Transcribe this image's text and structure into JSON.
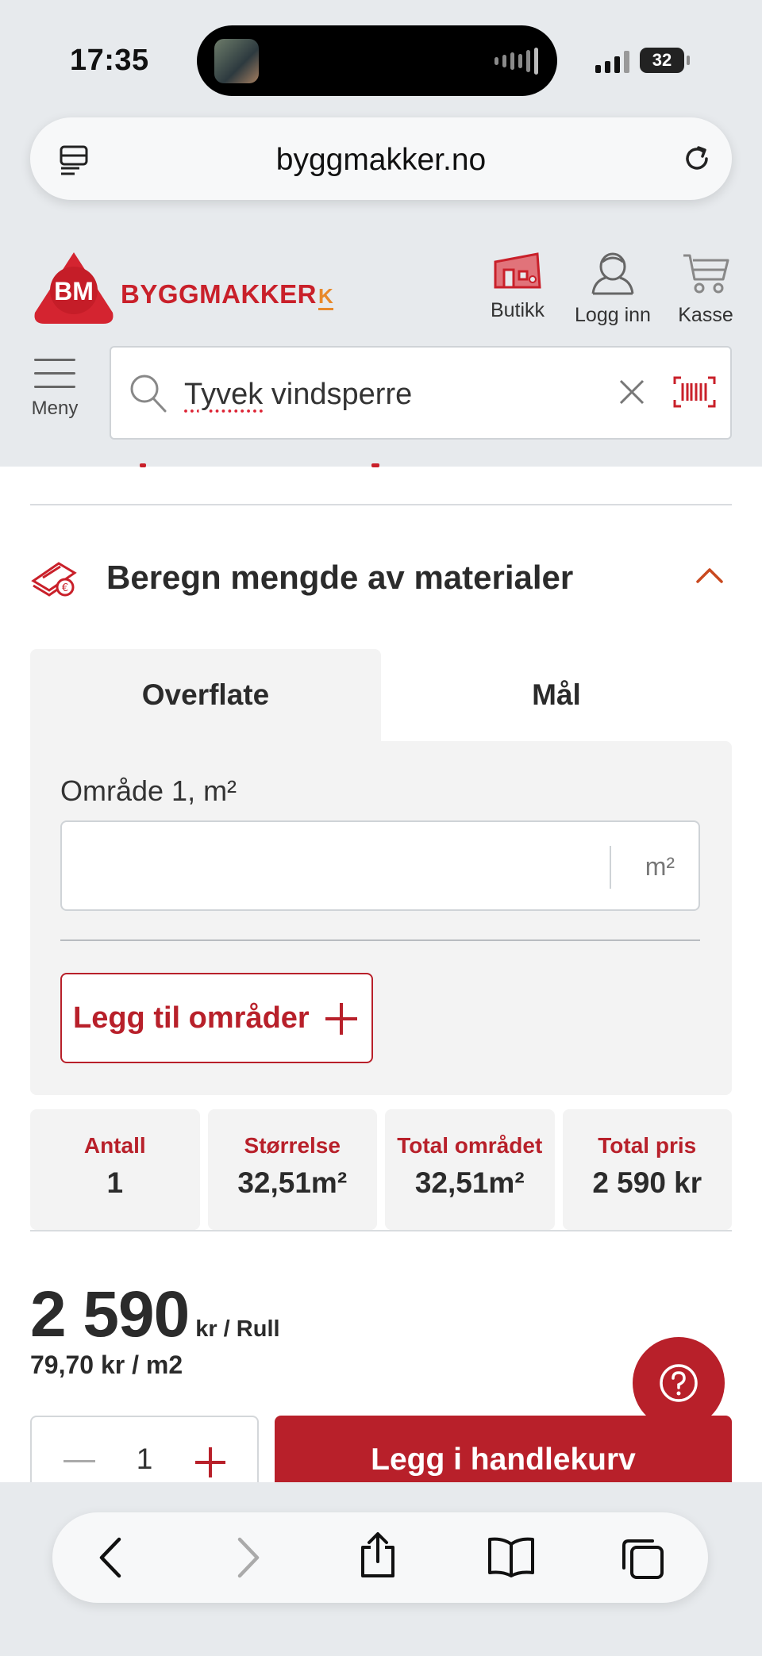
{
  "status_bar": {
    "time": "17:35",
    "battery": "32"
  },
  "browser": {
    "url": "byggmakker.no"
  },
  "header": {
    "logo_mark": "BM",
    "brand": "BYGGMAKKER",
    "brand_suffix": "K",
    "store_label": "Butikk",
    "login_label": "Logg inn",
    "cart_label": "Kasse",
    "menu_label": "Meny",
    "search_value_underlined": "Tyvek",
    "search_value_rest": " vindsperre"
  },
  "calculator": {
    "title": "Beregn mengde av materialer",
    "tabs": [
      {
        "label": "Overflate",
        "active": true
      },
      {
        "label": "Mål",
        "active": false
      }
    ],
    "area_label": "Område 1, m²",
    "area_value": "",
    "area_unit": "m²",
    "add_area_label": "Legg til områder"
  },
  "summary": [
    {
      "key": "Antall",
      "value": "1"
    },
    {
      "key": "Størrelse",
      "value": "32,51m²"
    },
    {
      "key": "Total området",
      "value": "32,51m²"
    },
    {
      "key": "Total pris",
      "value": "2 590 kr"
    }
  ],
  "price": {
    "amount": "2 590",
    "unit": "kr / Rull",
    "per_m2": "79,70 kr / m2"
  },
  "purchase": {
    "quantity": "1",
    "add_to_cart_label": "Legg i handlekurv"
  },
  "colors": {
    "brand_red": "#b8202a",
    "accent_orange": "#e8892b",
    "panel_gray": "#f3f3f3"
  }
}
